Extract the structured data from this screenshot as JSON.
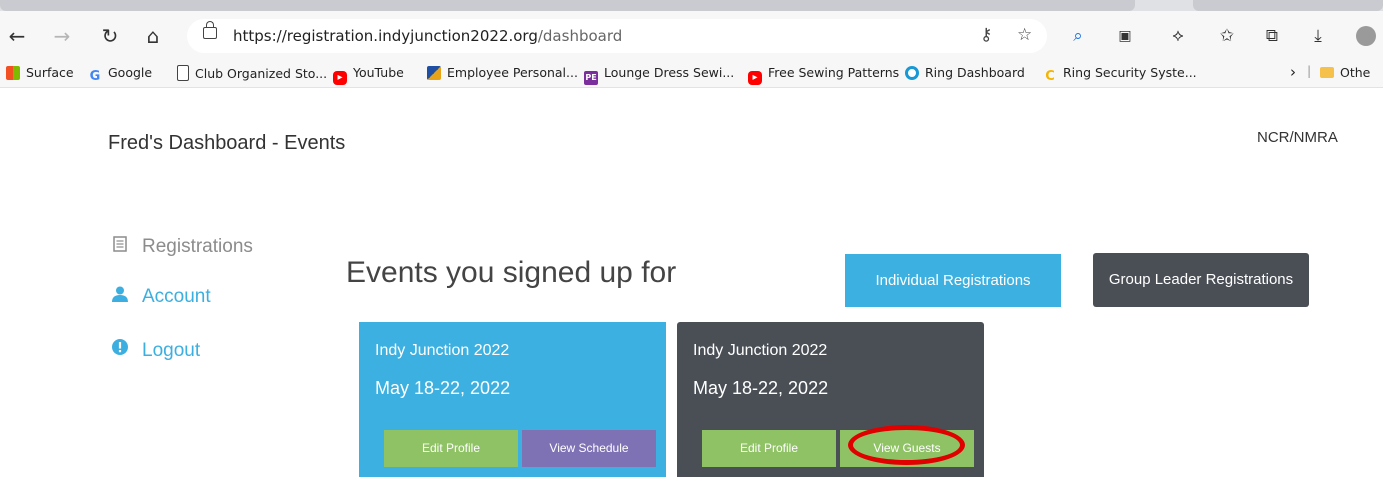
{
  "browser": {
    "url_host": "https://registration.indyjunction2022.org",
    "url_path": "/dashboard",
    "bookmarks": [
      {
        "label": "Surface",
        "icon": "windows-icon"
      },
      {
        "label": "Google",
        "icon": "google-icon"
      },
      {
        "label": "Club Organized Sto...",
        "icon": "page-icon"
      },
      {
        "label": "YouTube",
        "icon": "youtube-icon"
      },
      {
        "label": "Employee Personal...",
        "icon": "employee-icon"
      },
      {
        "label": "Lounge Dress Sewi...",
        "icon": "pe-icon"
      },
      {
        "label": "Free Sewing Patterns",
        "icon": "youtube-icon"
      },
      {
        "label": "Ring Dashboard",
        "icon": "ring-icon"
      },
      {
        "label": "Ring Security Syste...",
        "icon": "ring-security-icon"
      },
      {
        "label": "Othe",
        "icon": "folder-icon"
      }
    ]
  },
  "header": {
    "title": "Fred's Dashboard - Events",
    "org": "NCR/NMRA"
  },
  "sidebar": {
    "items": [
      {
        "label": "Registrations",
        "icon": "list-icon"
      },
      {
        "label": "Account",
        "icon": "user-icon"
      },
      {
        "label": "Logout",
        "icon": "alert-icon"
      }
    ]
  },
  "main": {
    "heading": "Events you signed up for",
    "individual_btn": "Individual Registrations",
    "group_btn": "Group Leader Registrations",
    "cards": [
      {
        "title": "Indy Junction 2022",
        "dates": "May 18-22, 2022",
        "btn1": "Edit Profile",
        "btn2": "View Schedule"
      },
      {
        "title": "Indy Junction 2022",
        "dates": "May 18-22, 2022",
        "btn1": "Edit Profile",
        "btn2": "View Guests"
      }
    ]
  },
  "colors": {
    "accent_blue": "#3cb0e0",
    "dark_card": "#4a4f56",
    "green_button": "#8fc265",
    "purple_button": "#7e72b4",
    "highlight_red": "#e00000"
  }
}
